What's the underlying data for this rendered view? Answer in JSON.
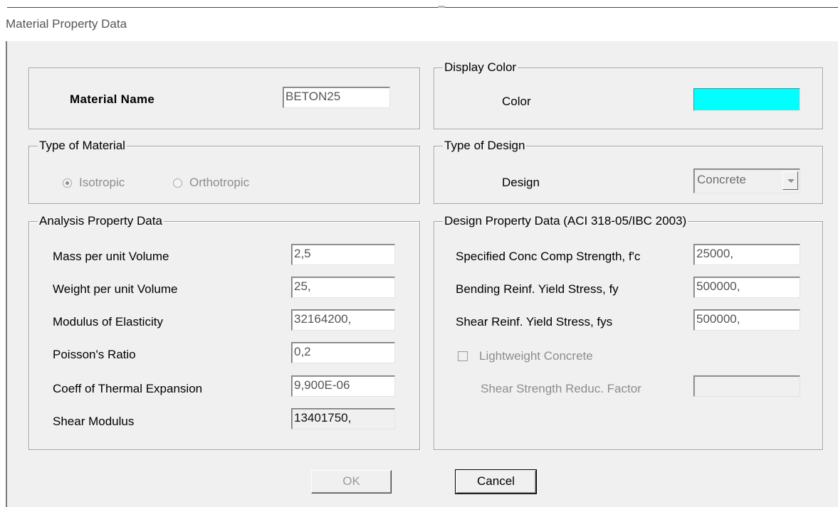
{
  "window": {
    "title": "Material Property Data"
  },
  "material_name": {
    "label": "Material Name",
    "value": "BETON25"
  },
  "display_color": {
    "group_label": "Display Color",
    "color_label": "Color",
    "color": "#00ffff"
  },
  "type_of_material": {
    "group_label": "Type of Material",
    "isotropic_label": "Isotropic",
    "orthotropic_label": "Orthotropic",
    "selected": "Isotropic"
  },
  "type_of_design": {
    "group_label": "Type of Design",
    "design_label": "Design",
    "design_value": "Concrete"
  },
  "analysis": {
    "group_label": "Analysis Property Data",
    "mass_label": "Mass per unit Volume",
    "mass_value": "2,5",
    "weight_label": "Weight per unit Volume",
    "weight_value": "25,",
    "modulus_label": "Modulus of Elasticity",
    "modulus_value": "32164200,",
    "poisson_label": "Poisson's Ratio",
    "poisson_value": "0,2",
    "thermal_label": "Coeff of Thermal Expansion",
    "thermal_value": "9,900E-06",
    "shear_label": "Shear Modulus",
    "shear_value": "13401750,"
  },
  "design": {
    "group_label": "Design Property Data (ACI 318-05/IBC 2003)",
    "fc_label": "Specified Conc Comp Strength, f'c",
    "fc_value": "25000,",
    "fy_label": "Bending Reinf. Yield Stress, fy",
    "fy_value": "500000,",
    "fys_label": "Shear Reinf. Yield Stress, fys",
    "fys_value": "500000,",
    "lightweight_label": "Lightweight Concrete",
    "lightweight_checked": false,
    "reduc_label": "Shear Strength Reduc. Factor",
    "reduc_value": ""
  },
  "buttons": {
    "ok": "OK",
    "cancel": "Cancel"
  }
}
